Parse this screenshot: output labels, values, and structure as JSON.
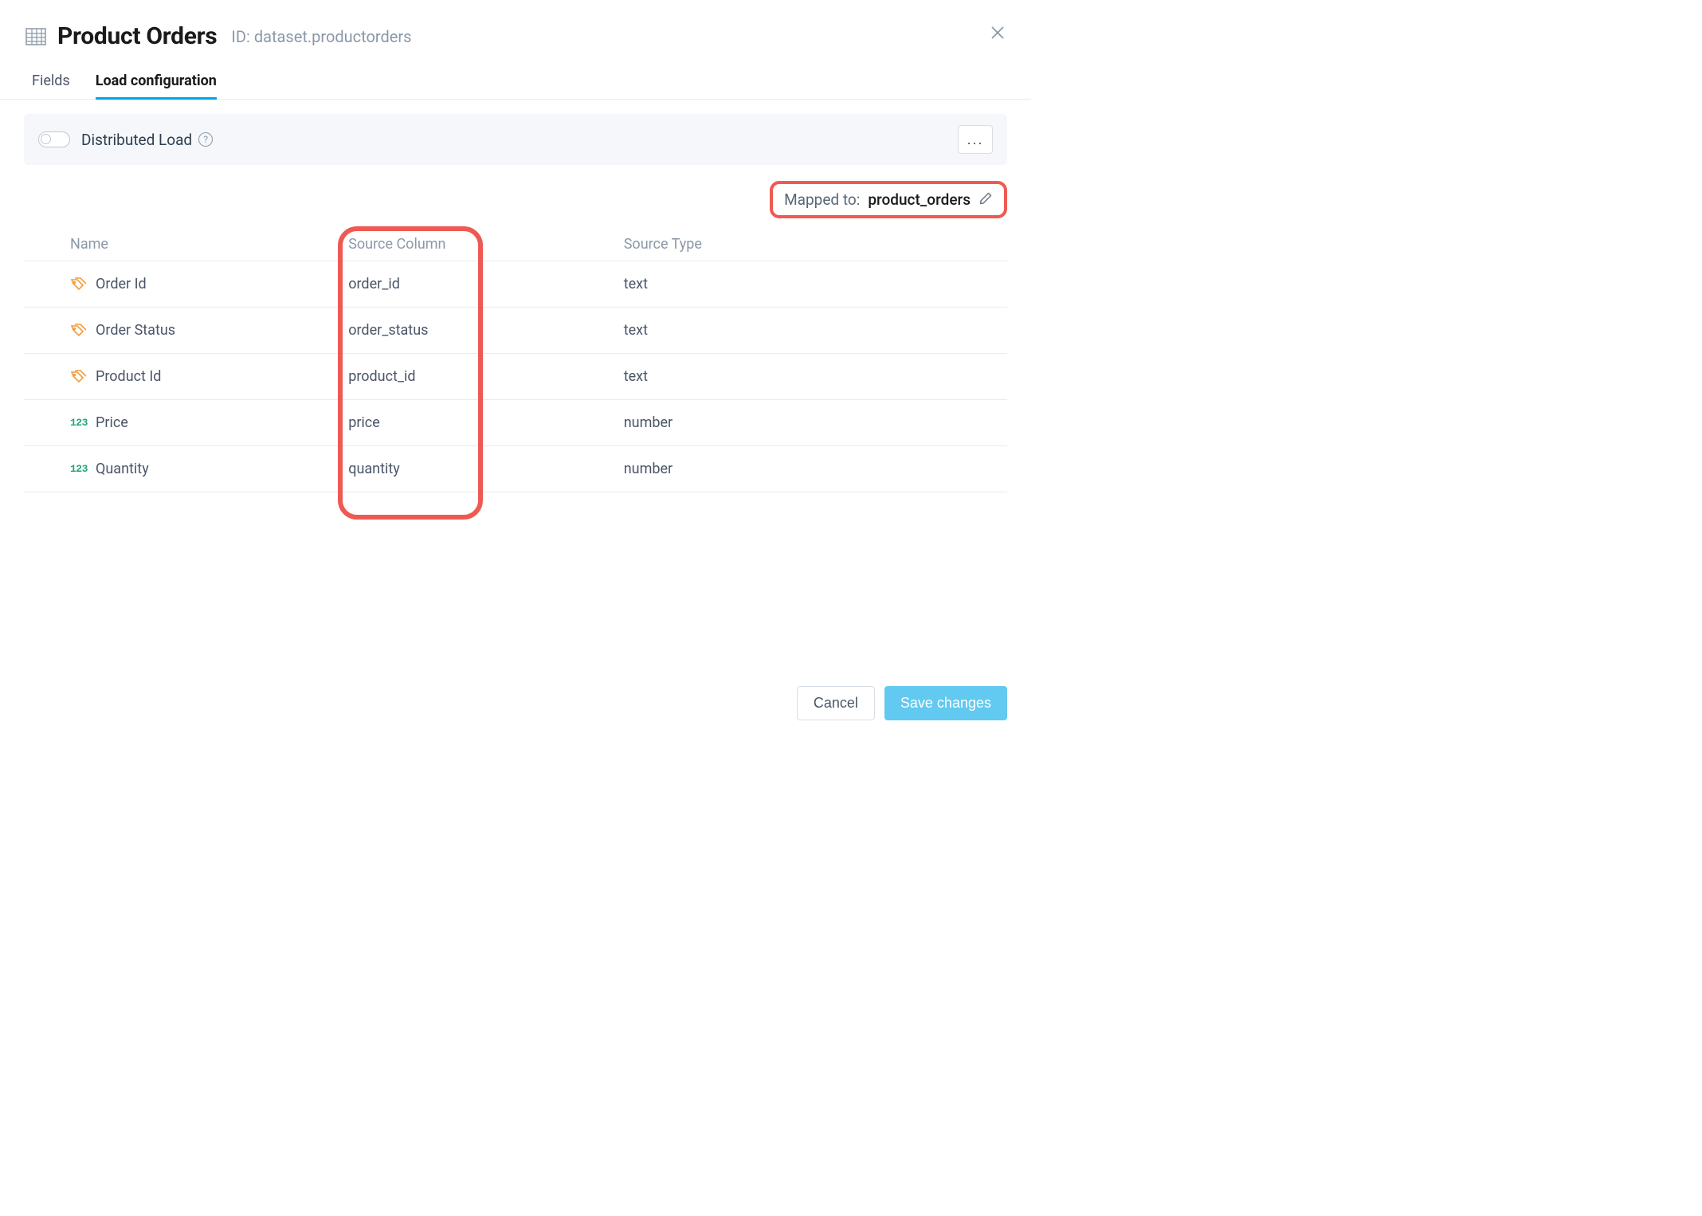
{
  "header": {
    "title": "Product Orders",
    "id_prefix": "ID:",
    "id_value": "dataset.productorders"
  },
  "tabs": {
    "fields": "Fields",
    "load_config": "Load configuration"
  },
  "config_bar": {
    "distributed_load": "Distributed Load",
    "more": "..."
  },
  "mapped_to": {
    "label": "Mapped to:",
    "value": "product_orders"
  },
  "table": {
    "headers": {
      "name": "Name",
      "source_column": "Source Column",
      "source_type": "Source Type"
    },
    "rows": [
      {
        "icon": "tag",
        "name": "Order Id",
        "source_column": "order_id",
        "source_type": "text"
      },
      {
        "icon": "tag",
        "name": "Order Status",
        "source_column": "order_status",
        "source_type": "text"
      },
      {
        "icon": "tag",
        "name": "Product Id",
        "source_column": "product_id",
        "source_type": "text"
      },
      {
        "icon": "num",
        "name": "Price",
        "source_column": "price",
        "source_type": "number"
      },
      {
        "icon": "num",
        "name": "Quantity",
        "source_column": "quantity",
        "source_type": "number"
      }
    ]
  },
  "footer": {
    "cancel": "Cancel",
    "save": "Save changes"
  },
  "icon_labels": {
    "num": "123"
  }
}
